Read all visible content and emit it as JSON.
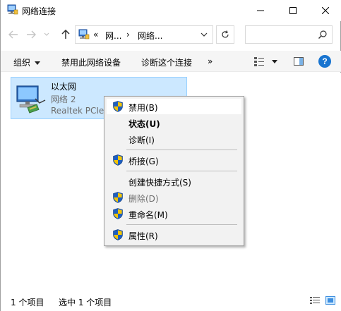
{
  "window": {
    "title": "网络连接"
  },
  "nav": {
    "breadcrumb_prefix": "«",
    "crumb1": "网...",
    "crumb_sep": "›",
    "crumb2": "网络...",
    "search_placeholder": ""
  },
  "toolbar": {
    "organize": "组织",
    "disable_device": "禁用此网络设备",
    "diagnose": "诊断这个连接",
    "more": "»"
  },
  "item": {
    "name": "以太网",
    "network": "网络 2",
    "adapter": "Realtek PCIe"
  },
  "context_menu": {
    "items": [
      {
        "label": "禁用(B)",
        "icon": "uac-shield-icon"
      },
      {
        "label": "状态(U)",
        "icon": ""
      },
      {
        "label": "诊断(I)",
        "icon": ""
      },
      {
        "label": "桥接(G)",
        "icon": "uac-shield-icon"
      },
      {
        "label": "创建快捷方式(S)",
        "icon": ""
      },
      {
        "label": "删除(D)",
        "icon": "uac-shield-icon"
      },
      {
        "label": "重命名(M)",
        "icon": "uac-shield-icon"
      },
      {
        "label": "属性(R)",
        "icon": "uac-shield-icon"
      }
    ]
  },
  "status": {
    "items_count": "1 个项目",
    "selected": "选中 1 个项目"
  },
  "colors": {
    "selection": "#cce8ff",
    "selection_border": "#99d1ff",
    "accent": "#1874d0",
    "menu_bg": "#f2f2f2"
  }
}
